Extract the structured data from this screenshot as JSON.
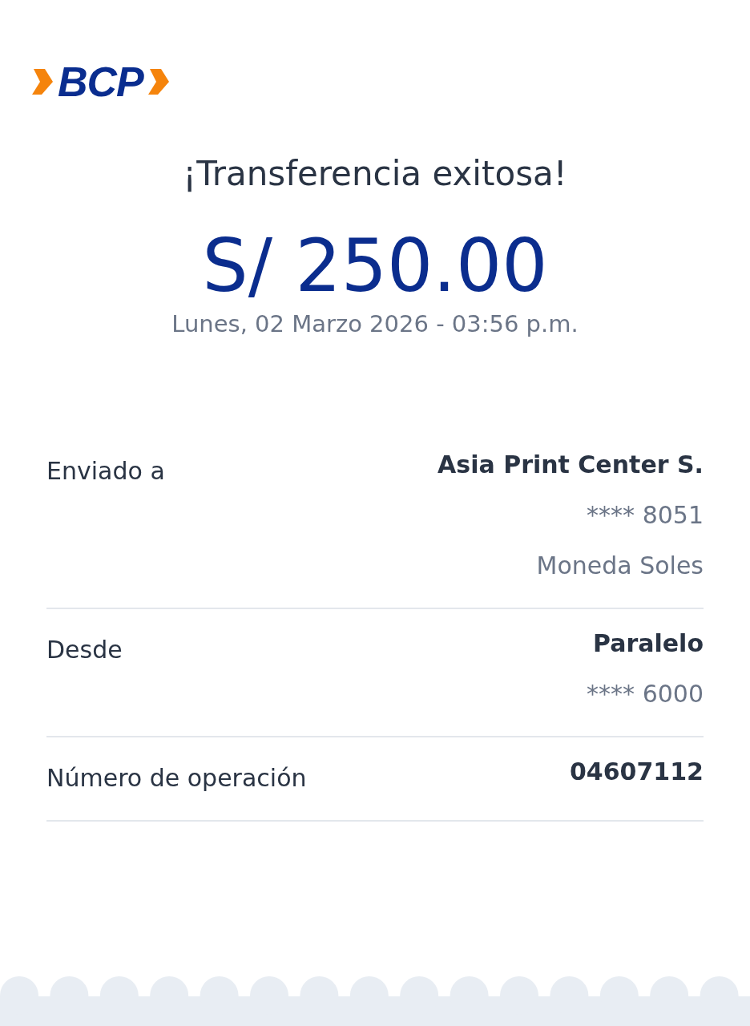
{
  "logo": {
    "text": "BCP"
  },
  "title": "¡Transferencia exitosa!",
  "amount": "S/ 250.00",
  "datetime": "Lunes, 02 Marzo 2026 - 03:56 p.m.",
  "details": [
    {
      "label": "Enviado a",
      "value": "Asia Print Center S.",
      "sub": [
        "**** 8051",
        "Moneda Soles"
      ]
    },
    {
      "label": "Desde",
      "value": "Paralelo",
      "sub": [
        "**** 6000"
      ]
    },
    {
      "label": "Número de operación",
      "value": "04607112"
    }
  ]
}
